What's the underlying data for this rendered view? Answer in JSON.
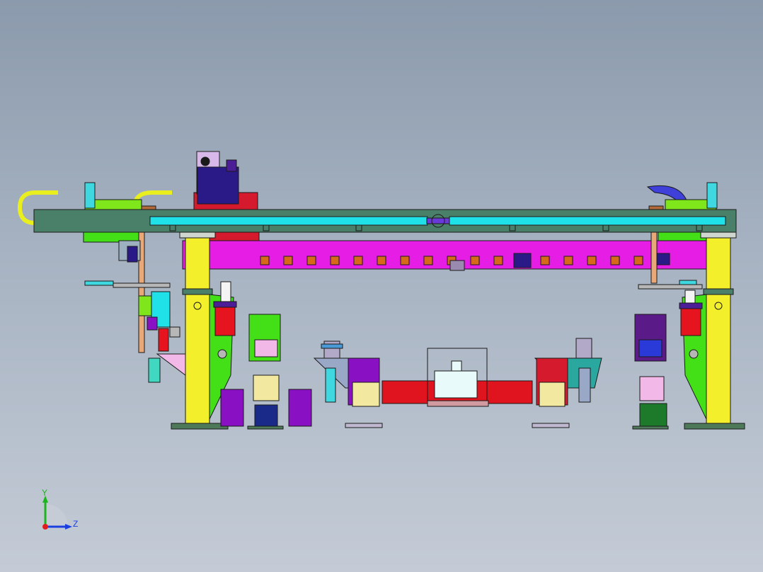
{
  "viewport": {
    "background_top": "#8b9aac",
    "background_bottom": "#c4cbd6"
  },
  "triad": {
    "y_label": "Y",
    "z_label": "Z",
    "y_color": "#1db51d",
    "z_color": "#1c3fe0",
    "origin_color": "#e11e1e"
  },
  "palette": {
    "beam": "#4a7f6a",
    "rail": "#20e0e8",
    "crossbar": "#e51de5",
    "column": "#f3ef2a",
    "pedestal": "#43e018",
    "cable_chain": "#e9ef1e",
    "blue_chain": "#3f3fd9",
    "cylinder": "#e6141e",
    "base_plate": "#4f7a5a",
    "fixture_red": "#e0141e",
    "fixture_purple": "#8a10c4",
    "orange_block": "#d76a1a"
  }
}
